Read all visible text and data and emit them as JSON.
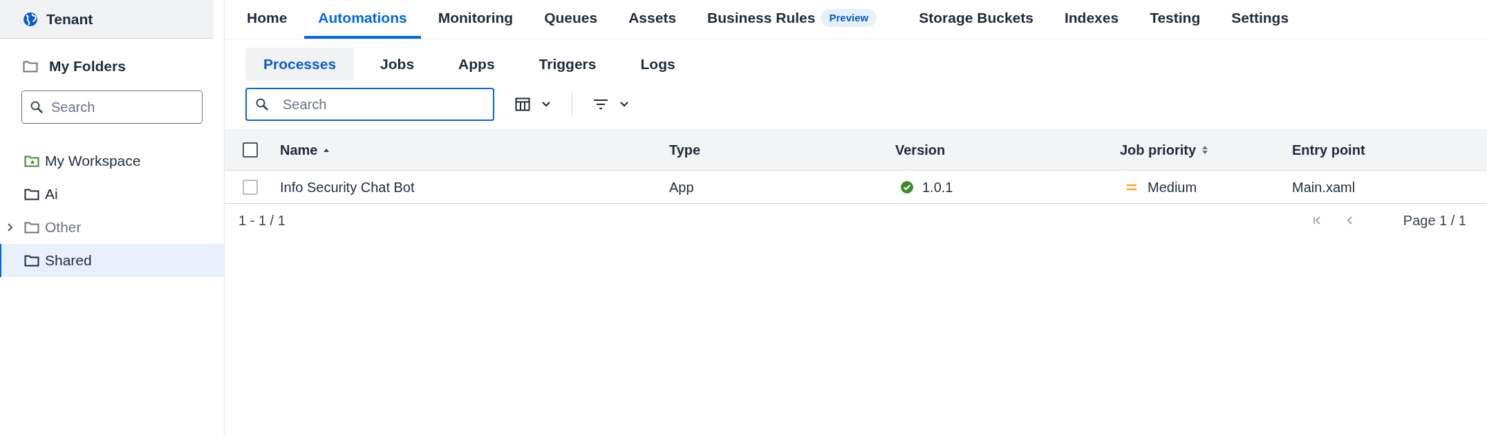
{
  "sidebar": {
    "tenant": "Tenant",
    "section_title": "My Folders",
    "search": {
      "placeholder": "Search"
    },
    "items": [
      {
        "label": "My Workspace",
        "kind": "workspace",
        "selected": false,
        "dimmed": false
      },
      {
        "label": "Ai",
        "kind": "folder",
        "selected": false,
        "dimmed": false
      },
      {
        "label": "Other",
        "kind": "folder",
        "selected": false,
        "dimmed": true,
        "expanded": false
      },
      {
        "label": "Shared",
        "kind": "folder",
        "selected": true,
        "dimmed": false
      }
    ]
  },
  "nav_tabs": [
    {
      "label": "Home",
      "selected": false
    },
    {
      "label": "Automations",
      "selected": true
    },
    {
      "label": "Monitoring",
      "selected": false
    },
    {
      "label": "Queues",
      "selected": false
    },
    {
      "label": "Assets",
      "selected": false
    },
    {
      "label": "Business Rules",
      "badge": "Preview",
      "selected": false
    },
    {
      "label": "Storage Buckets",
      "selected": false
    },
    {
      "label": "Indexes",
      "selected": false
    },
    {
      "label": "Testing",
      "selected": false
    },
    {
      "label": "Settings",
      "selected": false
    }
  ],
  "sub_tabs": [
    {
      "label": "Processes",
      "selected": true
    },
    {
      "label": "Jobs",
      "selected": false
    },
    {
      "label": "Apps",
      "selected": false
    },
    {
      "label": "Triggers",
      "selected": false
    },
    {
      "label": "Logs",
      "selected": false
    }
  ],
  "toolbar": {
    "search": {
      "placeholder": "Search"
    }
  },
  "table": {
    "select_all_checked": false,
    "columns": [
      {
        "label": "Name",
        "sorted": true
      },
      {
        "label": "Type",
        "sorted": false,
        "sortable": false
      },
      {
        "label": "Version",
        "sorted": false,
        "sortable": false
      },
      {
        "label": "Job priority",
        "sorted": false,
        "sortable": true
      },
      {
        "label": "Entry point",
        "sorted": false,
        "sortable": false
      }
    ],
    "rows": [
      {
        "checked": false,
        "name": "Info Security Chat Bot",
        "type": "App",
        "version": "1.0.1",
        "version_ok": true,
        "priority": "Medium",
        "entry_point": "Main.xaml"
      }
    ]
  },
  "footer": {
    "range": "1 - 1 / 1",
    "page": "Page 1 / 1"
  }
}
